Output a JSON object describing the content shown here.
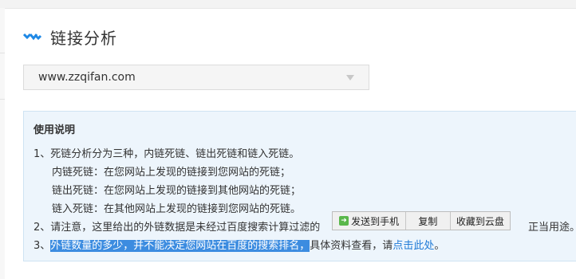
{
  "page": {
    "title": "链接分析",
    "logo_icon": "double-chevron-icon",
    "accent_color": "#1e88e5"
  },
  "site_select": {
    "value": "www.zzqifan.com",
    "arrow_icon": "chevron-down-icon"
  },
  "instructions": {
    "title": "使用说明",
    "line1": "1、死链分析分为三种，内链死链、链出死链和链入死链。",
    "line2": "内链死链：在您网站上发现的链接到您网站的死链；",
    "line3": "链出死链：在您网站上发现的链接到其他网站的死链；",
    "line4": "链入死链：在其他网站上发现的链接到您网站的死链。",
    "line5": "2、请注意，这里给出的外链数据是未经过百度搜索计算过滤的",
    "line5_tail": "正当用途。",
    "line6_prefix": "3、",
    "line6_highlight": "外链数量的多少，并不能决定您网站在百度的搜索排名，",
    "line6_rest": "具体资料查看，请",
    "line6_link": "点击此处",
    "line6_end": "。"
  },
  "popup": {
    "send_to_phone": "发送到手机",
    "phone_icon": "send-to-phone-icon",
    "copy": "复制",
    "save_to_cloud": "收藏到云盘"
  }
}
